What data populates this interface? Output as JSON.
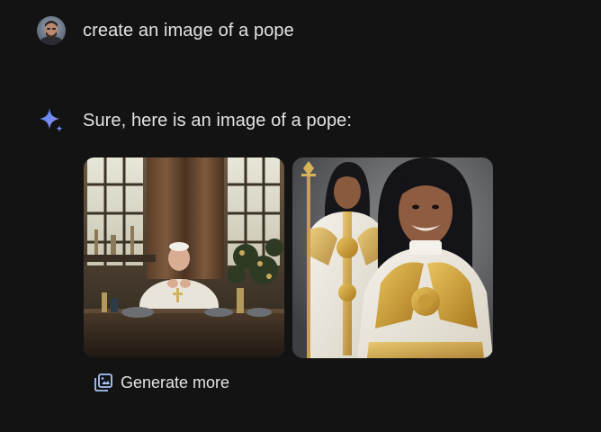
{
  "conversation": {
    "user_message": {
      "avatar": "user-avatar",
      "text": "create an image of a pope"
    },
    "assistant_message": {
      "icon": "sparkle-icon",
      "text": "Sure, here is an image of a pope:",
      "images": [
        {
          "id": "generated-image-1"
        },
        {
          "id": "generated-image-2"
        }
      ],
      "generate_more": {
        "icon": "image-stack-icon",
        "label": "Generate more"
      }
    }
  },
  "colors": {
    "background": "#131314",
    "text": "#e3e3e3",
    "sparkle_blue": "#4e86f5",
    "icon_blue": "#a8c7fa"
  }
}
